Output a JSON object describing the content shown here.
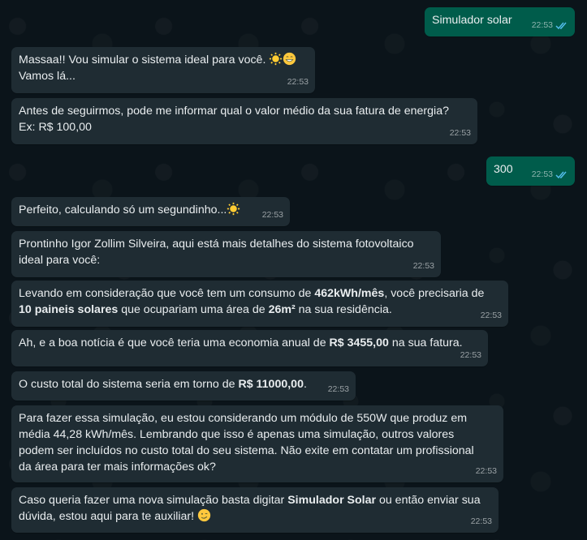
{
  "messages": [
    {
      "id": "m1",
      "dir": "out",
      "time": "22:53",
      "read": true,
      "text": "Simulador solar"
    },
    {
      "id": "m2",
      "dir": "in",
      "time": "22:53",
      "line1": "Massaa!! Vou simular o sistema ideal para você. ",
      "line2": "Vamos lá..."
    },
    {
      "id": "m3",
      "dir": "in",
      "time": "22:53",
      "line1": "Antes de seguirmos, pode me informar qual o valor médio da sua fatura de energia?",
      "line2": "Ex: R$ 100,00"
    },
    {
      "id": "m4",
      "dir": "out",
      "time": "22:53",
      "read": true,
      "text": "300"
    },
    {
      "id": "m5",
      "dir": "in",
      "time": "22:53",
      "text": "Perfeito, calculando só um segundinho..."
    },
    {
      "id": "m6",
      "dir": "in",
      "time": "22:53",
      "line1": "Prontinho Igor Zollim Silveira, aqui está mais detalhes do sistema fotovoltaico",
      "line2": "ideal para você:"
    },
    {
      "id": "m7",
      "dir": "in",
      "time": "22:53",
      "p1": "Levando em consideração que você tem um consumo de ",
      "b1": "462kWh/mês",
      "p2": ", você precisaria de",
      "b2": "10 paineis solares",
      "p3": " que ocupariam uma área de ",
      "b3": "26m²",
      "p4": " na sua residência."
    },
    {
      "id": "m8",
      "dir": "in",
      "time": "22:53",
      "p1": "Ah, e a boa notícia é que você teria uma economia anual de ",
      "b1": "R$ 3455,00",
      "p2": " na sua fatura."
    },
    {
      "id": "m9",
      "dir": "in",
      "time": "22:53",
      "p1": "O custo total do sistema seria em torno de ",
      "b1": "R$ 11000,00",
      "p2": "."
    },
    {
      "id": "m10",
      "dir": "in",
      "time": "22:53",
      "line1": "Para fazer essa simulação, eu estou considerando um módulo de 550W que produz em",
      "line2": "média 44,28 kWh/mês. Lembrando que isso é apenas uma simulação, outros valores",
      "line3": "podem ser incluídos no custo total do seu sistema. Não exite em contatar um profissional",
      "line4": "da área para ter mais informações ok?"
    },
    {
      "id": "m11",
      "dir": "in",
      "time": "22:53",
      "p1": "Caso queria fazer uma nova simulação basta digitar ",
      "b1": "Simulador Solar",
      "p2": " ou então enviar sua",
      "line2": "dúvida, estou aqui para te auxiliar! "
    }
  ],
  "colors": {
    "background": "#0b141a",
    "incoming_bubble": "#1f2c33",
    "outgoing_bubble": "#005c4b",
    "read_ticks": "#53bdeb"
  },
  "icons": {
    "sun": "sun-emoji-icon",
    "grin": "grinning-emoji-icon",
    "wink": "winking-emoji-icon",
    "read": "double-check-read-icon"
  }
}
